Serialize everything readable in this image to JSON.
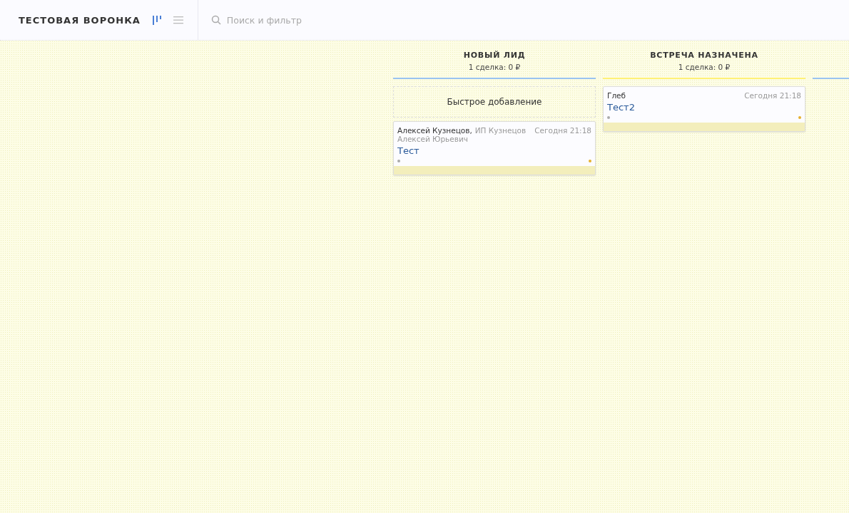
{
  "header": {
    "title": "ТЕСТОВАЯ ВОРОНКА",
    "search": {
      "placeholder": "Поиск и фильтр"
    }
  },
  "columns": [
    {
      "title": "НОВЫЙ ЛИД",
      "summary": "1 сделка: 0 ₽",
      "color": "#99c3f0",
      "quick_add": "Быстрое добавление",
      "cards": [
        {
          "contact": "Алексей Кузнецов,",
          "company": "ИП Кузнецов Алексей Юрьевич",
          "date": "Сегодня 21:18",
          "title": "Тест"
        }
      ]
    },
    {
      "title": "ВСТРЕЧА НАЗНАЧЕНА",
      "summary": "1 сделка: 0 ₽",
      "color": "#fff176",
      "cards": [
        {
          "contact": "Глеб",
          "date": "Сегодня 21:18",
          "title": "Тест2"
        }
      ]
    },
    {
      "color": "#99c3f0"
    }
  ]
}
